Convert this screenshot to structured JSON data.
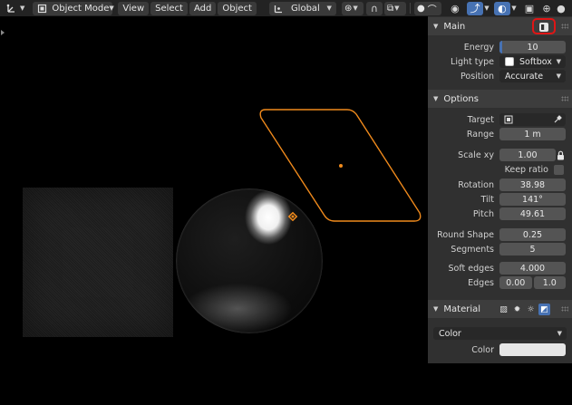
{
  "header": {
    "mode": "Object Mode",
    "menu": [
      "View",
      "Select",
      "Add",
      "Object"
    ],
    "transform_orientation": "Global"
  },
  "panel": {
    "main": {
      "title": "Main",
      "energy_label": "Energy",
      "energy_value": "10",
      "light_type_label": "Light type",
      "light_type_value": "Softbox",
      "position_label": "Position",
      "position_value": "Accurate"
    },
    "options": {
      "title": "Options",
      "target_label": "Target",
      "range_label": "Range",
      "range_value": "1 m",
      "scale_label": "Scale xy",
      "scale_value": "1.00",
      "keep_ratio_label": "Keep ratio",
      "rotation_label": "Rotation",
      "rotation_value": "38.98",
      "tilt_label": "Tilt",
      "tilt_value": "141°",
      "pitch_label": "Pitch",
      "pitch_value": "49.61",
      "round_shape_label": "Round Shape",
      "round_shape_value": "0.25",
      "segments_label": "Segments",
      "segments_value": "5",
      "soft_edges_label": "Soft edges",
      "soft_edges_value": "4.000",
      "edges_label": "Edges",
      "edges_value_a": "0.00",
      "edges_value_b": "1.0"
    },
    "material": {
      "title": "Material",
      "type_value": "Color",
      "color_label": "Color",
      "color_swatch": "#e6e6e6"
    }
  },
  "colors": {
    "accent": "#4772b3",
    "light_outline": "#f08a1c",
    "highlight_box": "#e01515"
  }
}
